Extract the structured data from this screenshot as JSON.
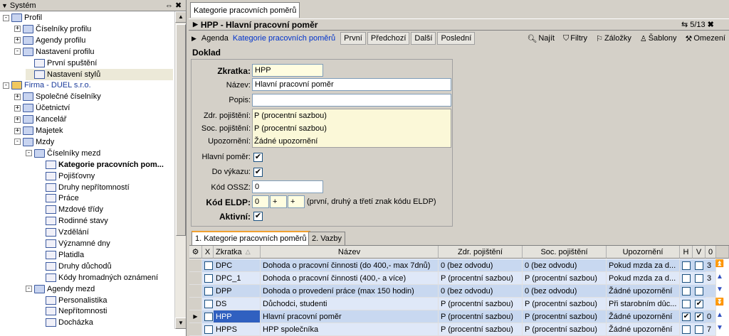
{
  "left_panel": {
    "title": "Systém",
    "items": [
      {
        "label": "Profil",
        "exp": "-",
        "indent": 0,
        "type": "folder"
      },
      {
        "label": "Číselníky profilu",
        "exp": "+",
        "indent": 1,
        "type": "folder"
      },
      {
        "label": "Agendy profilu",
        "exp": "+",
        "indent": 1,
        "type": "folder"
      },
      {
        "label": "Nastavení profilu",
        "exp": "-",
        "indent": 1,
        "type": "folder"
      },
      {
        "label": "První spuštění",
        "exp": "",
        "indent": 2,
        "type": "leaf"
      },
      {
        "label": "Nastavení stylů",
        "exp": "",
        "indent": 2,
        "type": "leaf",
        "selected": true
      },
      {
        "label": "Firma - DUEL s.r.o.",
        "exp": "-",
        "indent": 0,
        "type": "home"
      },
      {
        "label": "Společné číselníky",
        "exp": "+",
        "indent": 1,
        "type": "folder"
      },
      {
        "label": "Účetnictví",
        "exp": "+",
        "indent": 1,
        "type": "folder"
      },
      {
        "label": "Kancelář",
        "exp": "+",
        "indent": 1,
        "type": "folder"
      },
      {
        "label": "Majetek",
        "exp": "+",
        "indent": 1,
        "type": "folder"
      },
      {
        "label": "Mzdy",
        "exp": "-",
        "indent": 1,
        "type": "folder"
      },
      {
        "label": "Číselníky mezd",
        "exp": "-",
        "indent": 2,
        "type": "folder"
      },
      {
        "label": "Kategorie pracovních pom...",
        "exp": "",
        "indent": 3,
        "type": "leaf",
        "bold": true
      },
      {
        "label": "Pojišťovny",
        "exp": "",
        "indent": 3,
        "type": "leaf"
      },
      {
        "label": "Druhy nepřítomností",
        "exp": "",
        "indent": 3,
        "type": "leaf"
      },
      {
        "label": "Práce",
        "exp": "",
        "indent": 3,
        "type": "leaf"
      },
      {
        "label": "Mzdové třídy",
        "exp": "",
        "indent": 3,
        "type": "leaf"
      },
      {
        "label": "Rodinné stavy",
        "exp": "",
        "indent": 3,
        "type": "leaf"
      },
      {
        "label": "Vzdělání",
        "exp": "",
        "indent": 3,
        "type": "leaf"
      },
      {
        "label": "Významné dny",
        "exp": "",
        "indent": 3,
        "type": "leaf"
      },
      {
        "label": "Platidla",
        "exp": "",
        "indent": 3,
        "type": "leaf"
      },
      {
        "label": "Druhy důchodů",
        "exp": "",
        "indent": 3,
        "type": "leaf"
      },
      {
        "label": "Kódy hromadných oznámení",
        "exp": "",
        "indent": 3,
        "type": "leaf"
      },
      {
        "label": "Agendy mezd",
        "exp": "-",
        "indent": 2,
        "type": "folder"
      },
      {
        "label": "Personalistika",
        "exp": "",
        "indent": 3,
        "type": "leaf"
      },
      {
        "label": "Nepřítomnosti",
        "exp": "",
        "indent": 3,
        "type": "leaf"
      },
      {
        "label": "Docházka",
        "exp": "",
        "indent": 3,
        "type": "leaf"
      }
    ],
    "controls": "⇔ ✖"
  },
  "doc_tab": "Kategorie pracovních poměrů",
  "window": {
    "title": "HPP - Hlavní pracovní poměr",
    "counter": "5/13"
  },
  "toolbar": {
    "agenda_label": "Agenda",
    "agenda_link": "Kategorie pracovních poměrů",
    "nav": [
      "První",
      "Předchozí",
      "Další",
      "Poslední"
    ],
    "actions": [
      "Najít",
      "Filtry",
      "Záložky",
      "Šablony",
      "Omezení"
    ]
  },
  "form": {
    "section": "Doklad",
    "zkratka_label": "Zkratka:",
    "zkratka": "HPP",
    "nazev_label": "Název:",
    "nazev": "Hlavní pracovní poměr",
    "popis_label": "Popis:",
    "popis": "",
    "zdr_label": "Zdr. pojištění:",
    "zdr": "P (procentní sazbou)",
    "soc_label": "Soc. pojištění:",
    "soc": "P (procentní sazbou)",
    "upoz_label": "Upozornění:",
    "upoz": "Žádné upozornění",
    "hlavni_label": "Hlavní poměr:",
    "vykaz_label": "Do výkazu:",
    "kod_ossz_label": "Kód OSSZ:",
    "kod_ossz": "0",
    "kod_eldp_label": "Kód ELDP:",
    "kod_eldp": [
      "0",
      "+",
      "+"
    ],
    "kod_eldp_hint": "(první, druhý a třetí znak kódu ELDP)",
    "aktivni_label": "Aktivní:",
    "check_mark": "✔"
  },
  "bottom_tabs": [
    "1. Kategorie pracovních poměrů",
    "2. Vazby"
  ],
  "grid": {
    "headers": [
      "X",
      "Zkratka",
      "Název",
      "Zdr. pojištění",
      "Soc. pojištění",
      "Upozornění",
      "H",
      "V",
      "0"
    ],
    "rows": [
      {
        "zkratka": "DPC",
        "nazev": "Dohoda o pracovní činnosti (do 400,- max 7dnů)",
        "zdr": "0 (bez odvodu)",
        "soc": "0 (bez odvodu)",
        "upoz": "Pokud mzda za d...",
        "h": false,
        "v": false,
        "o": "3"
      },
      {
        "zkratka": "DPC_1",
        "nazev": "Dohoda o pracovní činnosti (400,- a více)",
        "zdr": "P (procentní sazbou)",
        "soc": "P (procentní sazbou)",
        "upoz": "Pokud mzda za d...",
        "h": false,
        "v": false,
        "o": "3"
      },
      {
        "zkratka": "DPP",
        "nazev": "Dohoda o provedení práce (max 150 hodin)",
        "zdr": "0 (bez odvodu)",
        "soc": "0 (bez odvodu)",
        "upoz": "Žádné upozornění",
        "h": false,
        "v": false,
        "o": ""
      },
      {
        "zkratka": "DS",
        "nazev": "Důchodci, studenti",
        "zdr": "P (procentní sazbou)",
        "soc": "P (procentní sazbou)",
        "upoz": "Při starobním dûc...",
        "h": false,
        "v": true,
        "o": ""
      },
      {
        "zkratka": "HPP",
        "nazev": "Hlavní pracovní poměr",
        "zdr": "P (procentní sazbou)",
        "soc": "P (procentní sazbou)",
        "upoz": "Žádné upozornění",
        "h": true,
        "v": true,
        "o": "0",
        "selected": true
      },
      {
        "zkratka": "HPPS",
        "nazev": "HPP společníka",
        "zdr": "P (procentní sazbou)",
        "soc": "P (procentní sazbou)",
        "upoz": "Žádné upozornění",
        "h": false,
        "v": false,
        "o": "7"
      }
    ]
  },
  "colors": {
    "row_blue": "#c8d8f0",
    "row_alt": "#dfe8f8",
    "selected": "#3060c0",
    "folder_blue": "#3c5aa0"
  }
}
